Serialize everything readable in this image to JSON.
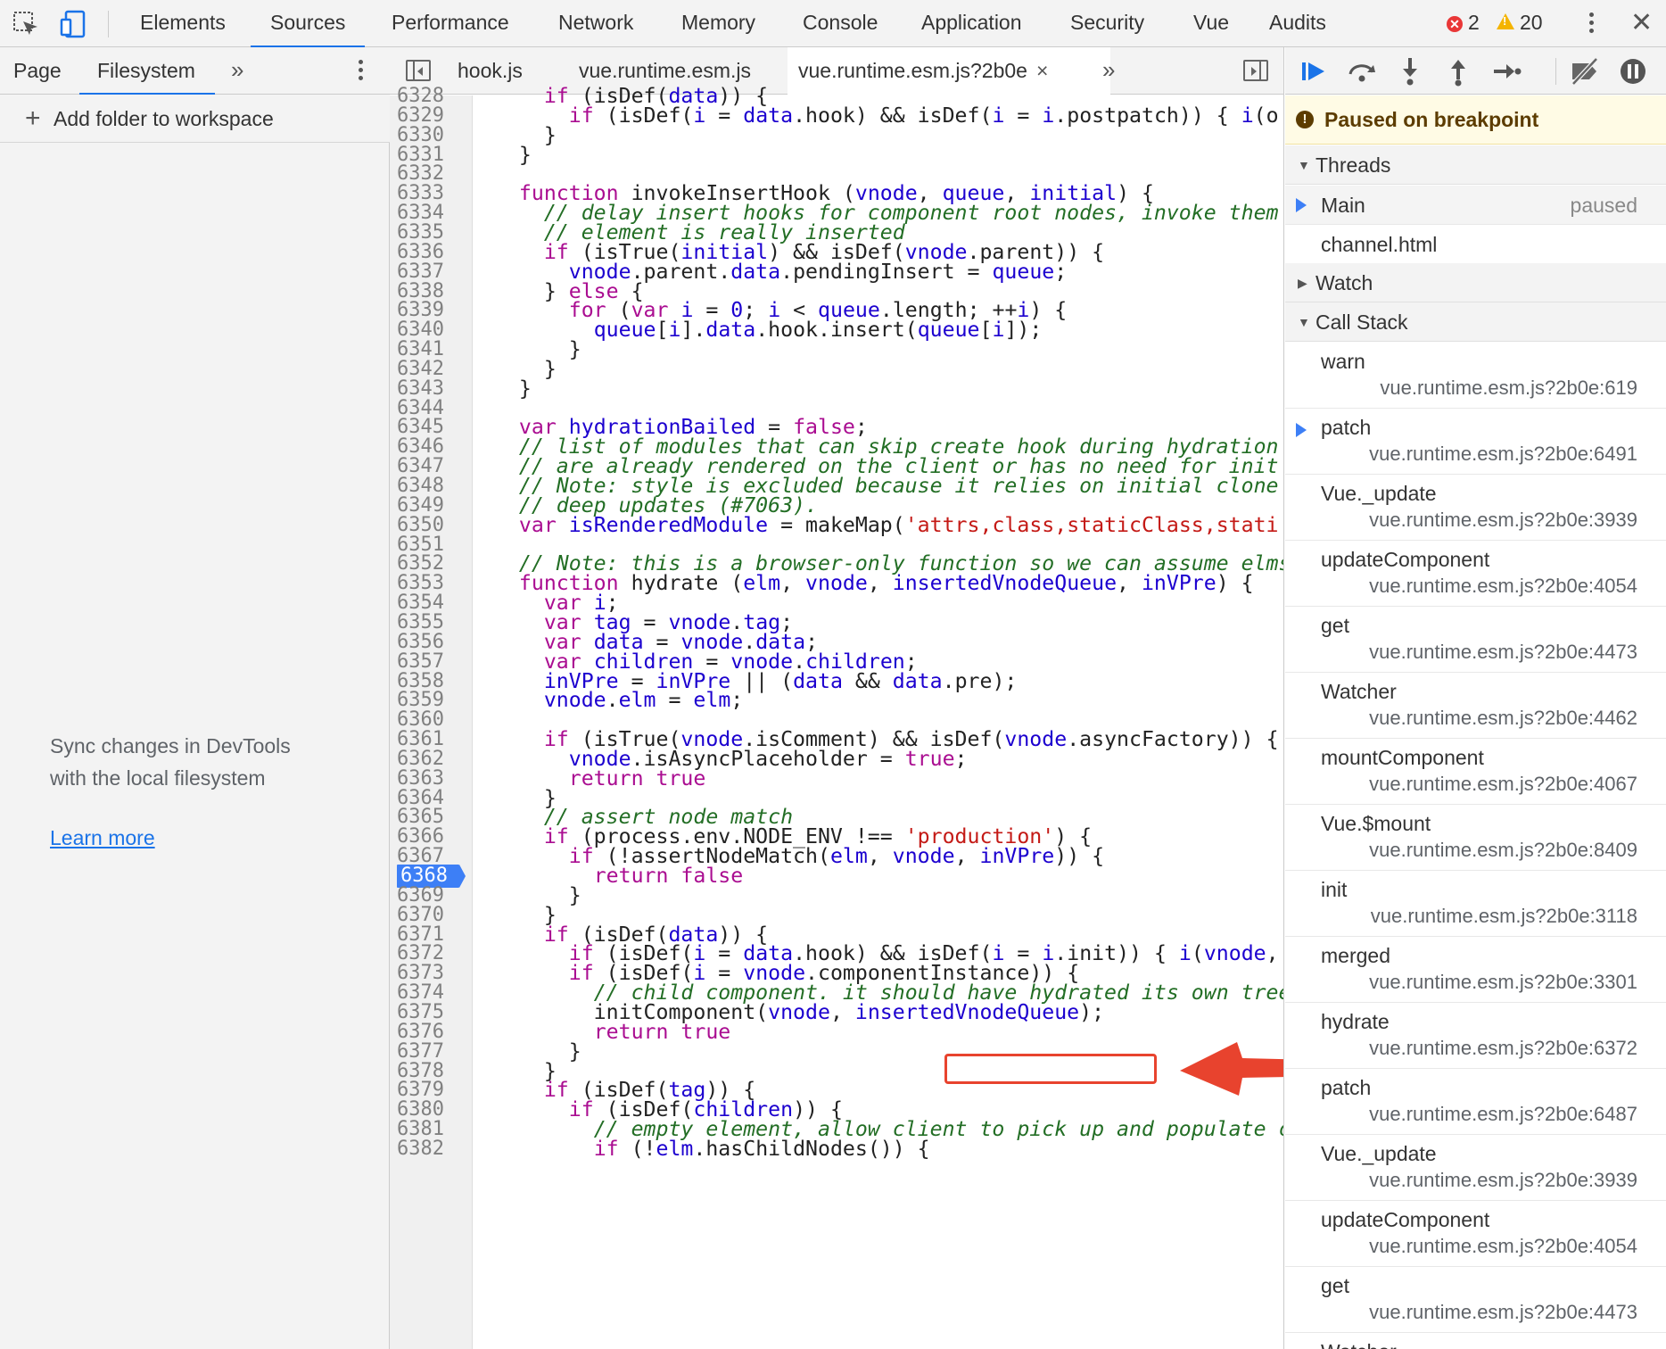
{
  "toolbar": {
    "tabs": [
      "Elements",
      "Sources",
      "Performance",
      "Network",
      "Memory",
      "Console",
      "Application",
      "Security",
      "Vue",
      "Audits"
    ],
    "active_tab": "Sources",
    "errors": "2",
    "warnings": "20",
    "icons": [
      "inspect-element-icon",
      "device-toolbar-icon",
      "more-vert-icon",
      "close-icon"
    ]
  },
  "navigator": {
    "tabs": [
      "Page",
      "Filesystem"
    ],
    "active_tab": "Filesystem",
    "more": "»",
    "add_folder": "Add folder to workspace",
    "sync_line1": "Sync changes in DevTools",
    "sync_line2": "with the local filesystem",
    "learn_more": "Learn more"
  },
  "editor": {
    "tabs": [
      "hook.js",
      "vue.runtime.esm.js",
      "vue.runtime.esm.js?2b0e"
    ],
    "active_tab": "vue.runtime.esm.js?2b0e",
    "tab_close": "×",
    "more": "»",
    "breakpoint_line": "6368",
    "lines": [
      {
        "n": "6328",
        "t": "    if (isDef(data)) {"
      },
      {
        "n": "6329",
        "t": "      if (isDef(i = data.hook) && isDef(i = i.postpatch)) { i(o"
      },
      {
        "n": "6330",
        "t": "    }"
      },
      {
        "n": "6331",
        "t": "  }"
      },
      {
        "n": "6332",
        "t": ""
      },
      {
        "n": "6333",
        "t": "  function invokeInsertHook (vnode, queue, initial) {"
      },
      {
        "n": "6334",
        "t": "    // delay insert hooks for component root nodes, invoke them"
      },
      {
        "n": "6335",
        "t": "    // element is really inserted"
      },
      {
        "n": "6336",
        "t": "    if (isTrue(initial) && isDef(vnode.parent)) {"
      },
      {
        "n": "6337",
        "t": "      vnode.parent.data.pendingInsert = queue;"
      },
      {
        "n": "6338",
        "t": "    } else {"
      },
      {
        "n": "6339",
        "t": "      for (var i = 0; i < queue.length; ++i) {"
      },
      {
        "n": "6340",
        "t": "        queue[i].data.hook.insert(queue[i]);"
      },
      {
        "n": "6341",
        "t": "      }"
      },
      {
        "n": "6342",
        "t": "    }"
      },
      {
        "n": "6343",
        "t": "  }"
      },
      {
        "n": "6344",
        "t": ""
      },
      {
        "n": "6345",
        "t": "  var hydrationBailed = false;"
      },
      {
        "n": "6346",
        "t": "  // list of modules that can skip create hook during hydration"
      },
      {
        "n": "6347",
        "t": "  // are already rendered on the client or has no need for init"
      },
      {
        "n": "6348",
        "t": "  // Note: style is excluded because it relies on initial clone"
      },
      {
        "n": "6349",
        "t": "  // deep updates (#7063)."
      },
      {
        "n": "6350",
        "t": "  var isRenderedModule = makeMap('attrs,class,staticClass,stati"
      },
      {
        "n": "6351",
        "t": ""
      },
      {
        "n": "6352",
        "t": "  // Note: this is a browser-only function so we can assume elms"
      },
      {
        "n": "6353",
        "t": "  function hydrate (elm, vnode, insertedVnodeQueue, inVPre) {"
      },
      {
        "n": "6354",
        "t": "    var i;"
      },
      {
        "n": "6355",
        "t": "    var tag = vnode.tag;"
      },
      {
        "n": "6356",
        "t": "    var data = vnode.data;"
      },
      {
        "n": "6357",
        "t": "    var children = vnode.children;"
      },
      {
        "n": "6358",
        "t": "    inVPre = inVPre || (data && data.pre);"
      },
      {
        "n": "6359",
        "t": "    vnode.elm = elm;"
      },
      {
        "n": "6360",
        "t": ""
      },
      {
        "n": "6361",
        "t": "    if (isTrue(vnode.isComment) && isDef(vnode.asyncFactory)) {"
      },
      {
        "n": "6362",
        "t": "      vnode.isAsyncPlaceholder = true;"
      },
      {
        "n": "6363",
        "t": "      return true"
      },
      {
        "n": "6364",
        "t": "    }"
      },
      {
        "n": "6365",
        "t": "    // assert node match"
      },
      {
        "n": "6366",
        "t": "    if (process.env.NODE_ENV !== 'production') {"
      },
      {
        "n": "6367",
        "t": "      if (!assertNodeMatch(elm, vnode, inVPre)) {"
      },
      {
        "n": "6368",
        "t": "        return false"
      },
      {
        "n": "6369",
        "t": "      }"
      },
      {
        "n": "6370",
        "t": "    }"
      },
      {
        "n": "6371",
        "t": "    if (isDef(data)) {"
      },
      {
        "n": "6372",
        "t": "      if (isDef(i = data.hook) && isDef(i = i.init)) { i(vnode,"
      },
      {
        "n": "6373",
        "t": "      if (isDef(i = vnode.componentInstance)) {"
      },
      {
        "n": "6374",
        "t": "        // child component. it should have hydrated its own tree"
      },
      {
        "n": "6375",
        "t": "        initComponent(vnode, insertedVnodeQueue);"
      },
      {
        "n": "6376",
        "t": "        return true"
      },
      {
        "n": "6377",
        "t": "      }"
      },
      {
        "n": "6378",
        "t": "    }"
      },
      {
        "n": "6379",
        "t": "    if (isDef(tag)) {"
      },
      {
        "n": "6380",
        "t": "      if (isDef(children)) {"
      },
      {
        "n": "6381",
        "t": "        // empty element, allow client to pick up and populate c"
      },
      {
        "n": "6382",
        "t": "        if (!elm.hasChildNodes()) {"
      }
    ]
  },
  "debugger": {
    "buttons": [
      "resume-icon",
      "step-over-icon",
      "step-into-icon",
      "step-out-icon",
      "step-icon",
      "deactivate-breakpoints-icon",
      "pause-on-exceptions-icon"
    ],
    "paused_message": "Paused on breakpoint",
    "threads_header": "Threads",
    "threads": [
      {
        "name": "Main",
        "status": "paused",
        "current": true
      },
      {
        "name": "channel.html",
        "status": "",
        "current": false
      }
    ],
    "watch_header": "Watch",
    "callstack_header": "Call Stack",
    "frames": [
      {
        "fn": "warn",
        "loc": "vue.runtime.esm.js?2b0e:619",
        "current": false
      },
      {
        "fn": "patch",
        "loc": "vue.runtime.esm.js?2b0e:6491",
        "current": true
      },
      {
        "fn": "Vue._update",
        "loc": "vue.runtime.esm.js?2b0e:3939",
        "current": false
      },
      {
        "fn": "updateComponent",
        "loc": "vue.runtime.esm.js?2b0e:4054",
        "current": false
      },
      {
        "fn": "get",
        "loc": "vue.runtime.esm.js?2b0e:4473",
        "current": false
      },
      {
        "fn": "Watcher",
        "loc": "vue.runtime.esm.js?2b0e:4462",
        "current": false
      },
      {
        "fn": "mountComponent",
        "loc": "vue.runtime.esm.js?2b0e:4067",
        "current": false
      },
      {
        "fn": "Vue.$mount",
        "loc": "vue.runtime.esm.js?2b0e:8409",
        "current": false
      },
      {
        "fn": "init",
        "loc": "vue.runtime.esm.js?2b0e:3118",
        "current": false
      },
      {
        "fn": "merged",
        "loc": "vue.runtime.esm.js?2b0e:3301",
        "current": false
      },
      {
        "fn": "hydrate",
        "loc": "vue.runtime.esm.js?2b0e:6372",
        "current": false
      },
      {
        "fn": "patch",
        "loc": "vue.runtime.esm.js?2b0e:6487",
        "current": false
      },
      {
        "fn": "Vue._update",
        "loc": "vue.runtime.esm.js?2b0e:3939",
        "current": false
      },
      {
        "fn": "updateComponent",
        "loc": "vue.runtime.esm.js?2b0e:4054",
        "current": false
      },
      {
        "fn": "get",
        "loc": "vue.runtime.esm.js?2b0e:4473",
        "current": false
      },
      {
        "fn": "Watcher",
        "loc": "",
        "current": false
      }
    ]
  },
  "annotation": {
    "highlight_color": "#e8432e"
  }
}
